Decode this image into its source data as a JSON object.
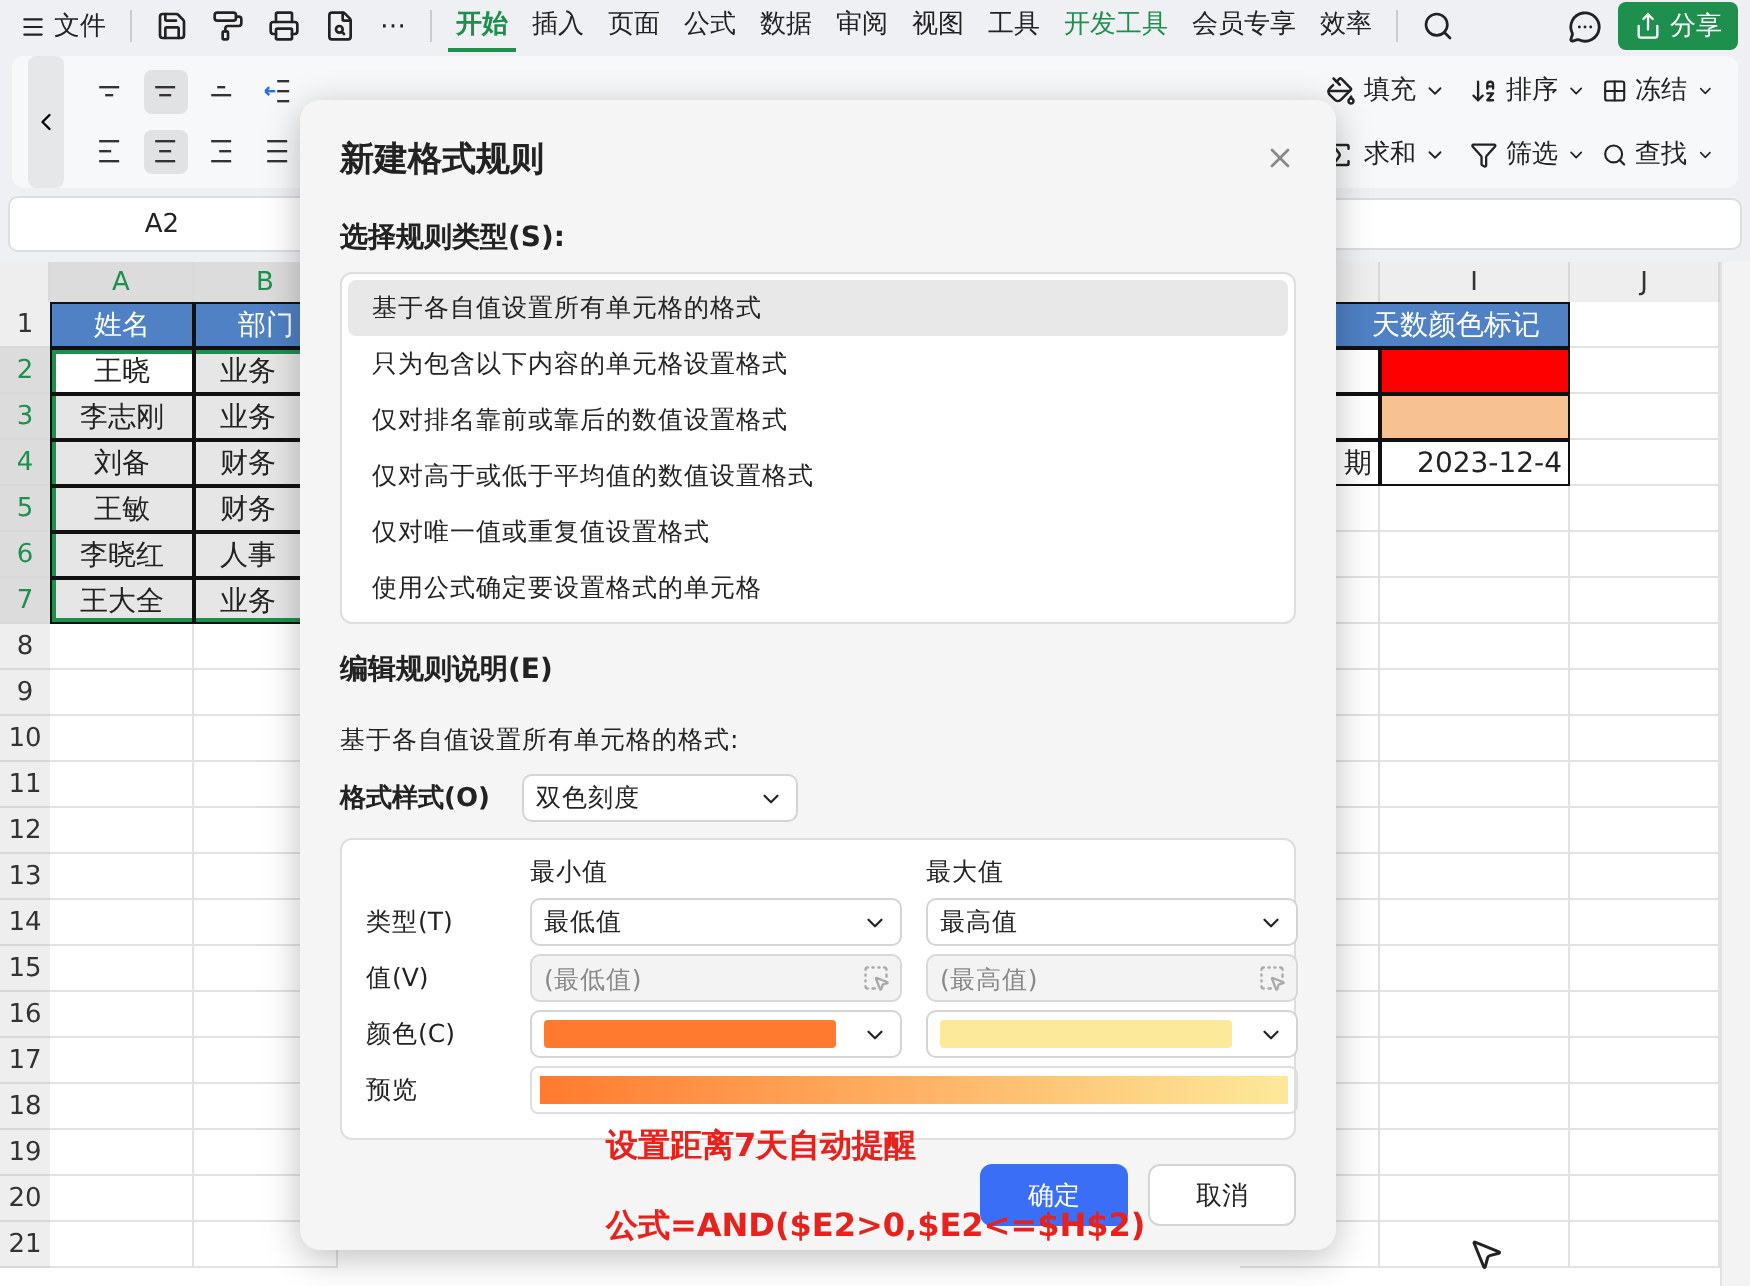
{
  "menu_bar": {
    "file": "文件",
    "more": "⋯",
    "tabs": [
      {
        "label": "开始",
        "selected": true,
        "accent": false
      },
      {
        "label": "插入",
        "selected": false,
        "accent": false
      },
      {
        "label": "页面",
        "selected": false,
        "accent": false
      },
      {
        "label": "公式",
        "selected": false,
        "accent": false
      },
      {
        "label": "数据",
        "selected": false,
        "accent": false
      },
      {
        "label": "审阅",
        "selected": false,
        "accent": false
      },
      {
        "label": "视图",
        "selected": false,
        "accent": false
      },
      {
        "label": "工具",
        "selected": false,
        "accent": false
      },
      {
        "label": "开发工具",
        "selected": false,
        "accent": true
      },
      {
        "label": "会员专享",
        "selected": false,
        "accent": false
      },
      {
        "label": "效率",
        "selected": false,
        "accent": false
      }
    ],
    "share": "分享"
  },
  "ribbon": {
    "align_buttons": [
      {
        "kind": "top",
        "selected": false
      },
      {
        "kind": "middle",
        "selected": true
      },
      {
        "kind": "bottom",
        "selected": false
      },
      {
        "kind": "outdent",
        "selected": false
      },
      {
        "kind": "left",
        "selected": false
      },
      {
        "kind": "center",
        "selected": true
      },
      {
        "kind": "right",
        "selected": false
      },
      {
        "kind": "justify",
        "selected": false
      }
    ],
    "tools": [
      {
        "kind": "fill",
        "label": "填充"
      },
      {
        "kind": "sort",
        "label": "排序"
      },
      {
        "kind": "freeze",
        "label": "冻结"
      },
      {
        "kind": "sum",
        "label": "求和"
      },
      {
        "kind": "filter",
        "label": "筛选"
      },
      {
        "kind": "find",
        "label": "查找"
      }
    ]
  },
  "name_box": "A2",
  "sheet": {
    "column_headers": [
      {
        "label": "A",
        "selected": true
      },
      {
        "label": "B",
        "selected": true
      },
      {
        "label": "I",
        "selected": false
      },
      {
        "label": "J",
        "selected": false
      }
    ],
    "rows": [
      {
        "number": "1",
        "selected": false,
        "kind": "header",
        "a": "姓名",
        "b": "部门",
        "hi": "天数颜色标记"
      },
      {
        "number": "2",
        "selected": true,
        "active": true,
        "a": "王晓",
        "b": "业务",
        "h": "",
        "i": "",
        "color": "#ff0000"
      },
      {
        "number": "3",
        "selected": true,
        "active": false,
        "a": "李志刚",
        "b": "业务",
        "h": "",
        "i": "",
        "color": "#f8c191"
      },
      {
        "number": "4",
        "selected": true,
        "active": false,
        "a": "刘备",
        "b": "财务",
        "h": "期",
        "i": "2023-12-4"
      },
      {
        "number": "5",
        "selected": true,
        "active": false,
        "a": "王敏",
        "b": "财务"
      },
      {
        "number": "6",
        "selected": true,
        "active": false,
        "a": "李晓红",
        "b": "人事"
      },
      {
        "number": "7",
        "selected": true,
        "active": false,
        "a": "王大全",
        "b": "业务"
      },
      {
        "number": "8",
        "selected": false
      },
      {
        "number": "9",
        "selected": false
      },
      {
        "number": "10",
        "selected": false
      },
      {
        "number": "11",
        "selected": false
      },
      {
        "number": "12",
        "selected": false
      },
      {
        "number": "13",
        "selected": false
      },
      {
        "number": "14",
        "selected": false
      },
      {
        "number": "15",
        "selected": false
      },
      {
        "number": "16",
        "selected": false
      },
      {
        "number": "17",
        "selected": false
      },
      {
        "number": "18",
        "selected": false
      },
      {
        "number": "19",
        "selected": false
      },
      {
        "number": "20",
        "selected": false
      },
      {
        "number": "21",
        "selected": false
      }
    ]
  },
  "dialog": {
    "title": "新建格式规则",
    "rule_type_label": "选择规则类型(S):",
    "rule_types": [
      {
        "label": "基于各自值设置所有单元格的格式",
        "selected": true
      },
      {
        "label": "只为包含以下内容的单元格设置格式",
        "selected": false
      },
      {
        "label": "仅对排名靠前或靠后的数值设置格式",
        "selected": false
      },
      {
        "label": "仅对高于或低于平均值的数值设置格式",
        "selected": false
      },
      {
        "label": "仅对唯一值或重复值设置格式",
        "selected": false
      },
      {
        "label": "使用公式确定要设置格式的单元格",
        "selected": false
      }
    ],
    "edit_label": "编辑规则说明(E)",
    "description": "基于各自值设置所有单元格的格式:",
    "format_style_label": "格式样式(O)",
    "format_style": "双色刻度",
    "min_header": "最小值",
    "max_header": "最大值",
    "type_label": "类型(T)",
    "min_type": "最低值",
    "max_type": "最高值",
    "value_label": "值(V)",
    "min_value": {
      "placeholder": "(最低值)",
      "disabled": true
    },
    "max_value": {
      "placeholder": "(最高值)",
      "disabled": true
    },
    "color_label": "颜色(C)",
    "min_swatch": {
      "color": "#ff7a2e"
    },
    "max_swatch": {
      "color": "#fde99a"
    },
    "preview_label": "预览",
    "buttons": [
      {
        "label": "确定",
        "kind": "primary"
      },
      {
        "label": "取消",
        "kind": "secondary"
      }
    ]
  },
  "annotation": {
    "lines": [
      "设置距离7天自动提醒",
      "公式=AND($E2>0,$E2<=$H$2)"
    ]
  }
}
